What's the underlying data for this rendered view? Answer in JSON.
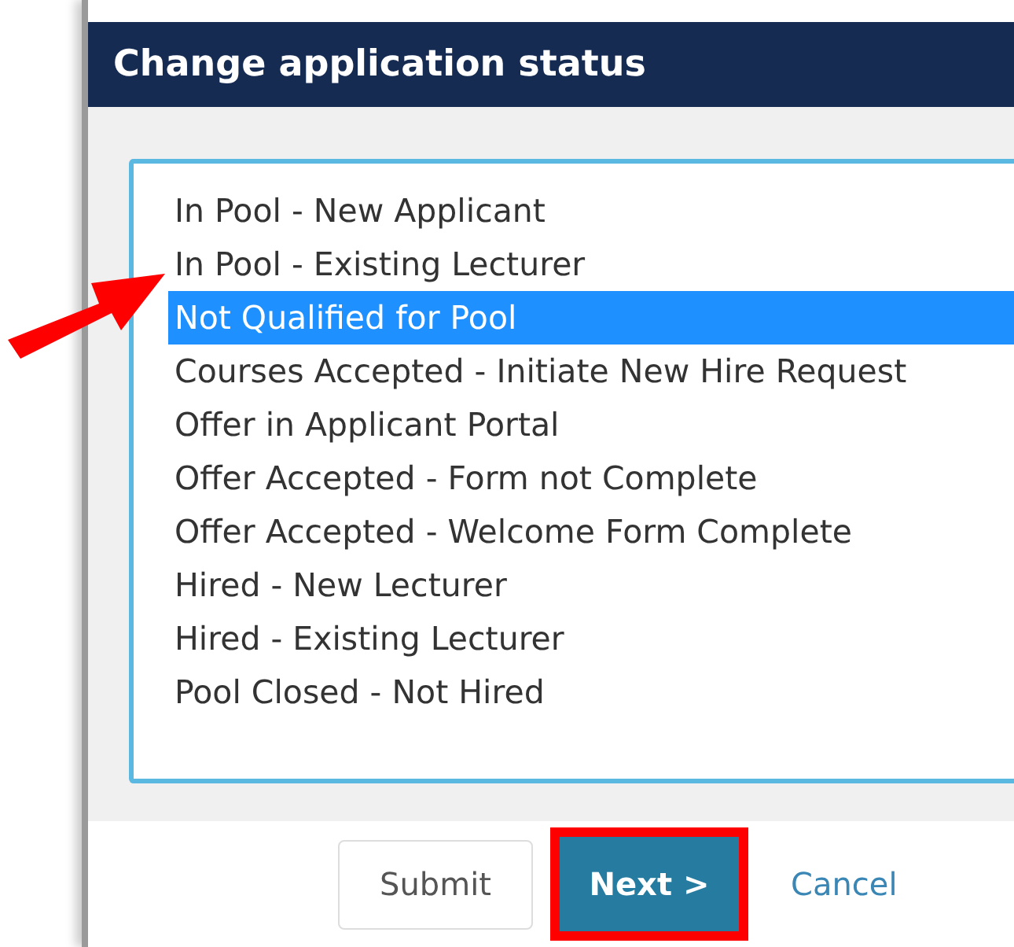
{
  "dialog": {
    "title": "Change application status",
    "options": [
      {
        "label": "In Pool - New Applicant",
        "selected": false
      },
      {
        "label": "In Pool - Existing Lecturer",
        "selected": false
      },
      {
        "label": "Not Qualified for Pool",
        "selected": true
      },
      {
        "label": "Courses Accepted - Initiate New Hire Request",
        "selected": false
      },
      {
        "label": "Offer in Applicant Portal",
        "selected": false
      },
      {
        "label": "Offer Accepted - Form not Complete",
        "selected": false
      },
      {
        "label": "Offer Accepted - Welcome Form Complete",
        "selected": false
      },
      {
        "label": "Hired - New Lecturer",
        "selected": false
      },
      {
        "label": "Hired - Existing Lecturer",
        "selected": false
      },
      {
        "label": "Pool Closed - Not Hired",
        "selected": false
      }
    ],
    "buttons": [
      {
        "label": "Submit",
        "kind": "default",
        "highlighted": false
      },
      {
        "label": "Next >",
        "kind": "primary",
        "highlighted": true
      },
      {
        "label": "Cancel",
        "kind": "link",
        "highlighted": false
      }
    ]
  }
}
